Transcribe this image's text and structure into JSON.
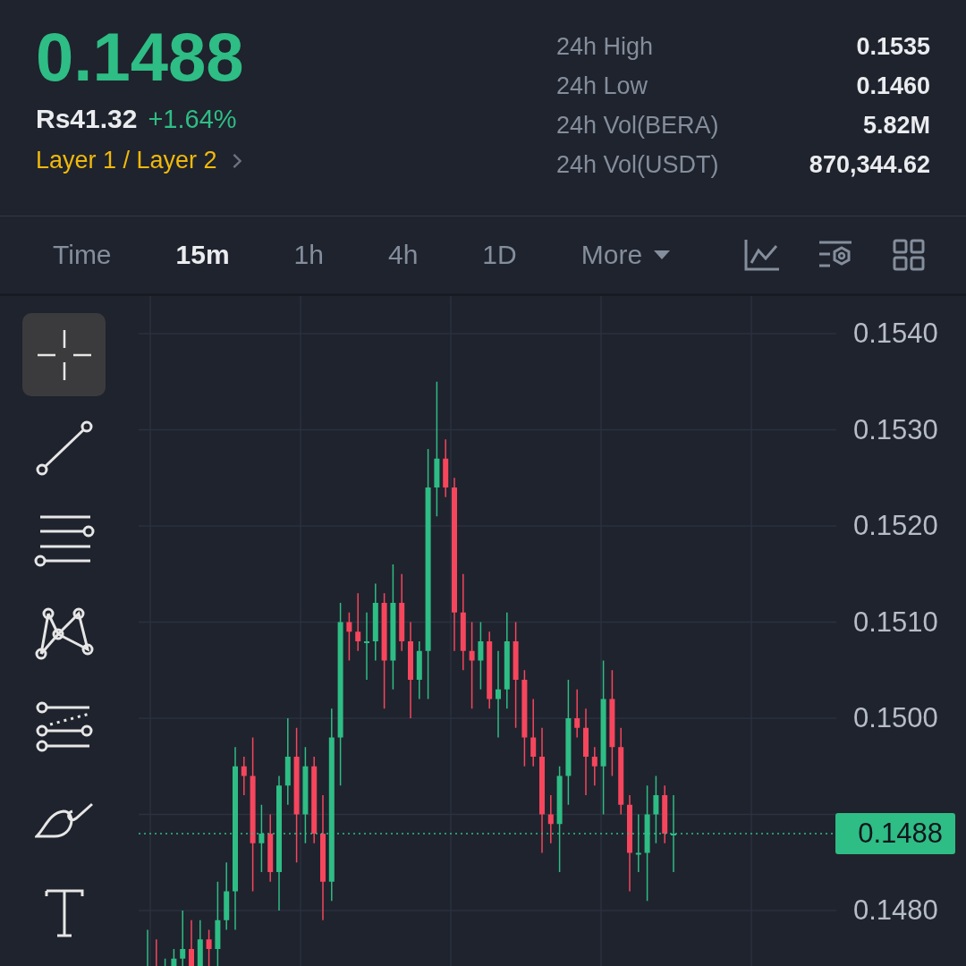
{
  "ticker": {
    "price": "0.1488",
    "local_price": "Rs41.32",
    "change": "+1.64%",
    "category": "Layer 1 / Layer 2"
  },
  "stats": [
    {
      "label": "24h High",
      "value": "0.1535"
    },
    {
      "label": "24h Low",
      "value": "0.1460"
    },
    {
      "label": "24h Vol(BERA)",
      "value": "5.82M"
    },
    {
      "label": "24h Vol(USDT)",
      "value": "870,344.62"
    }
  ],
  "intervals": [
    {
      "label": "Time",
      "selected": false,
      "kind": "plain"
    },
    {
      "label": "15m",
      "selected": true,
      "kind": "plain"
    },
    {
      "label": "1h",
      "selected": false,
      "kind": "plain"
    },
    {
      "label": "4h",
      "selected": false,
      "kind": "plain"
    },
    {
      "label": "1D",
      "selected": false,
      "kind": "plain"
    },
    {
      "label": "More",
      "selected": false,
      "kind": "dropdown"
    }
  ],
  "tools": [
    {
      "kind": "crosshair",
      "selected": true
    },
    {
      "kind": "line",
      "selected": false
    },
    {
      "kind": "lines",
      "selected": false
    },
    {
      "kind": "pattern",
      "selected": false
    },
    {
      "kind": "channel",
      "selected": false
    },
    {
      "kind": "brush",
      "selected": false
    },
    {
      "kind": "text",
      "selected": false
    }
  ],
  "chart": {
    "price_axis": [
      "0.1540",
      "0.1530",
      "0.1520",
      "0.1510",
      "0.1500",
      "0.1480"
    ],
    "last_price": "0.1488"
  }
}
